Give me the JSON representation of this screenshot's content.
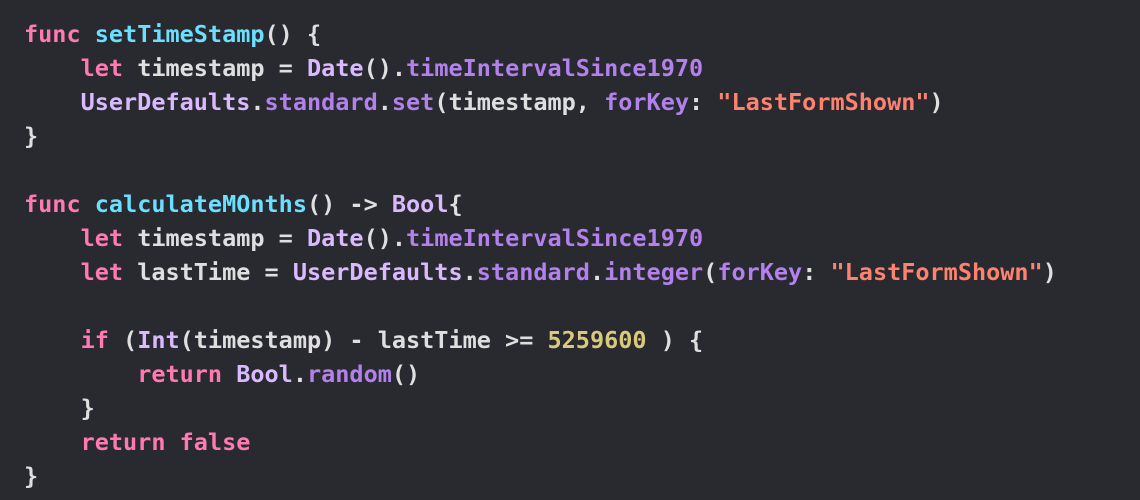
{
  "colors": {
    "background": "#292a30",
    "plain": "#dfdfe0",
    "keyword": "#ff7ab2",
    "function_declaration": "#6bdfff",
    "type": "#dabaff",
    "member": "#b281eb",
    "string": "#ff8170",
    "number": "#d9c97c"
  },
  "code": {
    "lines": [
      [
        {
          "t": "kw",
          "v": "func"
        },
        {
          "t": "plain",
          "v": " "
        },
        {
          "t": "fn-decl",
          "v": "setTimeStamp"
        },
        {
          "t": "plain",
          "v": "() {"
        }
      ],
      [
        {
          "t": "plain",
          "v": "    "
        },
        {
          "t": "kw",
          "v": "let"
        },
        {
          "t": "plain",
          "v": " timestamp = "
        },
        {
          "t": "type",
          "v": "Date"
        },
        {
          "t": "plain",
          "v": "()."
        },
        {
          "t": "member",
          "v": "timeIntervalSince1970"
        }
      ],
      [
        {
          "t": "plain",
          "v": "    "
        },
        {
          "t": "type",
          "v": "UserDefaults"
        },
        {
          "t": "plain",
          "v": "."
        },
        {
          "t": "member",
          "v": "standard"
        },
        {
          "t": "plain",
          "v": "."
        },
        {
          "t": "member",
          "v": "set"
        },
        {
          "t": "plain",
          "v": "(timestamp, "
        },
        {
          "t": "param",
          "v": "forKey"
        },
        {
          "t": "plain",
          "v": ": "
        },
        {
          "t": "str",
          "v": "\"LastFormShown\""
        },
        {
          "t": "plain",
          "v": ")"
        }
      ],
      [
        {
          "t": "plain",
          "v": "}"
        }
      ],
      [],
      [
        {
          "t": "kw",
          "v": "func"
        },
        {
          "t": "plain",
          "v": " "
        },
        {
          "t": "fn-decl",
          "v": "calculateMOnths"
        },
        {
          "t": "plain",
          "v": "() -> "
        },
        {
          "t": "type",
          "v": "Bool"
        },
        {
          "t": "plain",
          "v": "{"
        }
      ],
      [
        {
          "t": "plain",
          "v": "    "
        },
        {
          "t": "kw",
          "v": "let"
        },
        {
          "t": "plain",
          "v": " timestamp = "
        },
        {
          "t": "type",
          "v": "Date"
        },
        {
          "t": "plain",
          "v": "()."
        },
        {
          "t": "member",
          "v": "timeIntervalSince1970"
        }
      ],
      [
        {
          "t": "plain",
          "v": "    "
        },
        {
          "t": "kw",
          "v": "let"
        },
        {
          "t": "plain",
          "v": " lastTime = "
        },
        {
          "t": "type",
          "v": "UserDefaults"
        },
        {
          "t": "plain",
          "v": "."
        },
        {
          "t": "member",
          "v": "standard"
        },
        {
          "t": "plain",
          "v": "."
        },
        {
          "t": "member",
          "v": "integer"
        },
        {
          "t": "plain",
          "v": "("
        },
        {
          "t": "param",
          "v": "forKey"
        },
        {
          "t": "plain",
          "v": ": "
        },
        {
          "t": "str",
          "v": "\"LastFormShown\""
        },
        {
          "t": "plain",
          "v": ")"
        }
      ],
      [],
      [
        {
          "t": "plain",
          "v": "    "
        },
        {
          "t": "kw",
          "v": "if"
        },
        {
          "t": "plain",
          "v": " ("
        },
        {
          "t": "type",
          "v": "Int"
        },
        {
          "t": "plain",
          "v": "(timestamp) - lastTime >= "
        },
        {
          "t": "num",
          "v": "5259600"
        },
        {
          "t": "plain",
          "v": " ) {"
        }
      ],
      [
        {
          "t": "plain",
          "v": "        "
        },
        {
          "t": "kw",
          "v": "return"
        },
        {
          "t": "plain",
          "v": " "
        },
        {
          "t": "type",
          "v": "Bool"
        },
        {
          "t": "plain",
          "v": "."
        },
        {
          "t": "member",
          "v": "random"
        },
        {
          "t": "plain",
          "v": "()"
        }
      ],
      [
        {
          "t": "plain",
          "v": "    }"
        }
      ],
      [
        {
          "t": "plain",
          "v": "    "
        },
        {
          "t": "kw",
          "v": "return"
        },
        {
          "t": "plain",
          "v": " "
        },
        {
          "t": "kw",
          "v": "false"
        }
      ],
      [
        {
          "t": "plain",
          "v": "}"
        }
      ]
    ]
  }
}
